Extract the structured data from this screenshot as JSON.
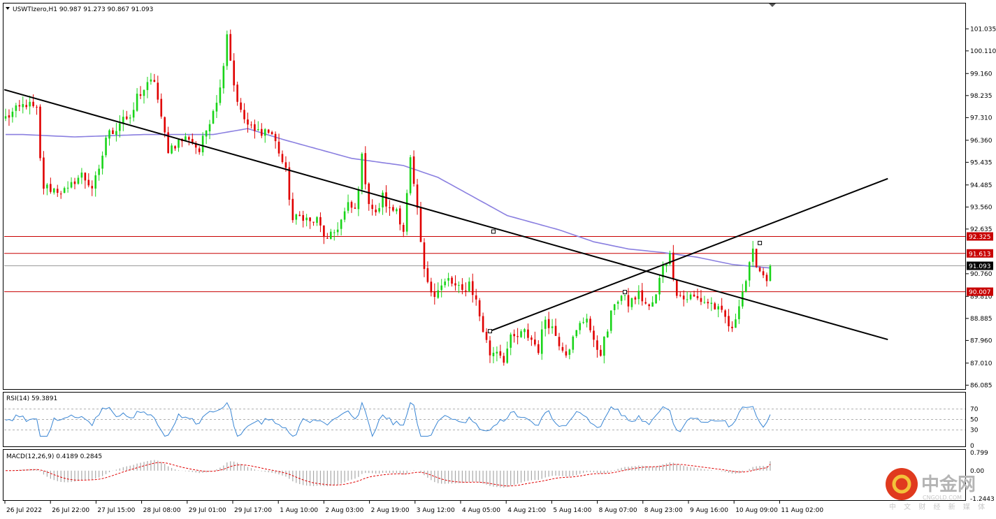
{
  "header": {
    "symbol_line": "USWTIzero,H1  90.987 91.273 90.867 91.093",
    "rsi_label": "RSI(14) 59.3891",
    "macd_label": "MACD(12,26,9) 0.4189 0.2845"
  },
  "watermark": {
    "brand_cn": "中金网",
    "brand_en": "CNGOLD.COM",
    "tagline": "中 文 财 经 新 媒 体"
  },
  "colors": {
    "bull": "#19d419",
    "bear": "#e00000",
    "ma": "#8a7fe0",
    "rsi": "#3a86d4",
    "hline": "#c80000",
    "trendline": "#000000",
    "macd_hist": "#a8a8a8",
    "macd_signal": "#e00000",
    "price_box": "#000000",
    "level_box": "#c80000"
  },
  "chart_data": {
    "type": "candlestick",
    "timeframe": "H1",
    "x_tick_labels": [
      "26 Jul 2022",
      "26 Jul 22:00",
      "27 Jul 15:00",
      "28 Jul 08:00",
      "29 Jul 01:00",
      "29 Jul 17:00",
      "1 Aug 10:00",
      "2 Aug 03:00",
      "2 Aug 19:00",
      "3 Aug 12:00",
      "4 Aug 05:00",
      "4 Aug 21:00",
      "5 Aug 14:00",
      "8 Aug 07:00",
      "8 Aug 23:00",
      "9 Aug 16:00",
      "10 Aug 09:00",
      "11 Aug 02:00"
    ],
    "y_ticks": [
      "101.035",
      "100.110",
      "99.160",
      "98.235",
      "97.310",
      "96.360",
      "95.435",
      "94.485",
      "93.560",
      "92.635",
      "90.760",
      "89.810",
      "88.885",
      "87.960",
      "87.010",
      "86.085"
    ],
    "ylim": [
      85.95,
      101.6
    ],
    "current_price": 91.093,
    "current_price_label": "91.093",
    "levels": [
      {
        "value": 92.325,
        "label": "92.325"
      },
      {
        "value": 91.613,
        "label": "91.613"
      },
      {
        "value": 90.007,
        "label": "90.007"
      }
    ],
    "price_anchors": [
      [
        0,
        97.3
      ],
      [
        6,
        97.9
      ],
      [
        9,
        97.6
      ],
      [
        10,
        95.5
      ],
      [
        11,
        94.4
      ],
      [
        14,
        94.3
      ],
      [
        18,
        94.2
      ],
      [
        20,
        94.7
      ],
      [
        22,
        94.9
      ],
      [
        25,
        94.4
      ],
      [
        27,
        95.0
      ],
      [
        29,
        96.5
      ],
      [
        32,
        96.9
      ],
      [
        34,
        97.4
      ],
      [
        36,
        97.1
      ],
      [
        38,
        98.2
      ],
      [
        40,
        98.5
      ],
      [
        43,
        98.9
      ],
      [
        45,
        97.2
      ],
      [
        47,
        96.0
      ],
      [
        50,
        96.3
      ],
      [
        53,
        96.5
      ],
      [
        56,
        95.9
      ],
      [
        58,
        96.8
      ],
      [
        60,
        97.7
      ],
      [
        62,
        98.5
      ],
      [
        64,
        100.9
      ],
      [
        66,
        98.7
      ],
      [
        68,
        97.5
      ],
      [
        70,
        97.0
      ],
      [
        72,
        96.7
      ],
      [
        75,
        96.8
      ],
      [
        77,
        96.6
      ],
      [
        79,
        95.9
      ],
      [
        81,
        95.0
      ],
      [
        83,
        93.0
      ],
      [
        86,
        93.2
      ],
      [
        88,
        92.9
      ],
      [
        90,
        93.0
      ],
      [
        93,
        92.1
      ],
      [
        95,
        92.5
      ],
      [
        97,
        93.0
      ],
      [
        99,
        93.6
      ],
      [
        101,
        93.4
      ],
      [
        103,
        95.6
      ],
      [
        105,
        93.8
      ],
      [
        107,
        93.2
      ],
      [
        109,
        94.0
      ],
      [
        111,
        93.4
      ],
      [
        113,
        93.5
      ],
      [
        115,
        92.6
      ],
      [
        117,
        95.5
      ],
      [
        119,
        93.3
      ],
      [
        121,
        90.8
      ],
      [
        124,
        89.9
      ],
      [
        126,
        90.2
      ],
      [
        128,
        90.5
      ],
      [
        130,
        90.2
      ],
      [
        132,
        90.0
      ],
      [
        134,
        90.4
      ],
      [
        136,
        89.6
      ],
      [
        138,
        88.4
      ],
      [
        140,
        87.4
      ],
      [
        142,
        87.6
      ],
      [
        144,
        87.2
      ],
      [
        146,
        88.0
      ],
      [
        148,
        88.1
      ],
      [
        150,
        88.3
      ],
      [
        152,
        88.0
      ],
      [
        154,
        87.6
      ],
      [
        156,
        88.9
      ],
      [
        158,
        88.5
      ],
      [
        160,
        87.9
      ],
      [
        162,
        87.5
      ],
      [
        164,
        88.0
      ],
      [
        166,
        88.6
      ],
      [
        168,
        89.0
      ],
      [
        170,
        87.8
      ],
      [
        172,
        87.5
      ],
      [
        174,
        88.4
      ],
      [
        176,
        89.6
      ],
      [
        178,
        89.8
      ],
      [
        180,
        89.5
      ],
      [
        183,
        89.9
      ],
      [
        186,
        89.3
      ],
      [
        188,
        89.8
      ],
      [
        190,
        91.2
      ],
      [
        192,
        91.5
      ],
      [
        194,
        90.0
      ],
      [
        196,
        89.7
      ],
      [
        198,
        89.8
      ],
      [
        200,
        89.7
      ],
      [
        202,
        89.6
      ],
      [
        204,
        89.5
      ],
      [
        206,
        89.2
      ],
      [
        208,
        88.9
      ],
      [
        210,
        88.3
      ],
      [
        212,
        89.6
      ],
      [
        214,
        90.5
      ],
      [
        216,
        91.6
      ],
      [
        218,
        90.9
      ],
      [
        220,
        90.6
      ],
      [
        221,
        91.093
      ]
    ],
    "ma_anchors": [
      [
        5,
        96.6
      ],
      [
        20,
        96.5
      ],
      [
        40,
        96.6
      ],
      [
        60,
        96.6
      ],
      [
        70,
        96.85
      ],
      [
        80,
        96.4
      ],
      [
        100,
        95.6
      ],
      [
        115,
        95.3
      ],
      [
        125,
        94.8
      ],
      [
        135,
        94.0
      ],
      [
        145,
        93.2
      ],
      [
        160,
        92.6
      ],
      [
        170,
        92.1
      ],
      [
        180,
        91.8
      ],
      [
        190,
        91.65
      ],
      [
        200,
        91.45
      ],
      [
        210,
        91.15
      ],
      [
        221,
        91.0
      ]
    ],
    "bar_count": 222,
    "rsi": {
      "period": 14,
      "last": 59.3891,
      "levels": [
        70,
        50,
        30
      ],
      "ticks": [
        "70",
        "50",
        "30",
        "0"
      ],
      "ylim": [
        0,
        100
      ]
    },
    "macd": {
      "fast": 12,
      "slow": 26,
      "signal_period": 9,
      "main": 0.4189,
      "signal": 0.2845,
      "ticks": [
        "0.799",
        "0.00",
        "-1.2443"
      ],
      "ylim": [
        -1.2443,
        0.799
      ]
    },
    "trendlines": [
      {
        "name": "descending",
        "from": [
          -2,
          98.55
        ],
        "to": [
          255,
          88.0
        ],
        "mid_marker": [
          141,
          92.53
        ]
      },
      {
        "name": "ascending",
        "from": [
          140,
          88.35
        ],
        "to": [
          255,
          94.75
        ],
        "markers": [
          [
            140,
            88.35
          ],
          [
            179,
            89.99
          ],
          [
            218,
            92.05
          ]
        ]
      }
    ]
  }
}
